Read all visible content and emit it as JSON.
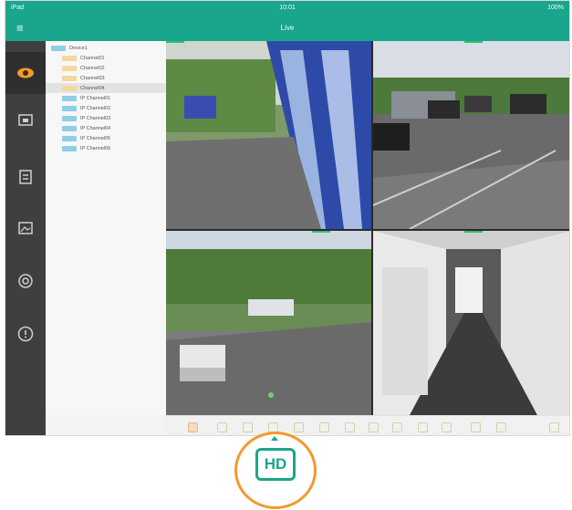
{
  "status_bar": {
    "carrier": "iPad",
    "time": "10:01",
    "battery": "100%"
  },
  "app": {
    "title": "Live",
    "menu_glyph": "≡"
  },
  "sidebar": {
    "items": [
      {
        "icon": "eye-icon",
        "active": true
      },
      {
        "icon": "playback-icon",
        "active": false
      },
      {
        "icon": "device-manager-icon",
        "active": false
      },
      {
        "icon": "image-icon",
        "active": false
      },
      {
        "icon": "settings-icon",
        "active": false
      },
      {
        "icon": "info-icon",
        "active": false
      }
    ]
  },
  "device_tree": {
    "items": [
      {
        "label": "Device1",
        "kind": "device"
      },
      {
        "label": "Channel01",
        "kind": "channel"
      },
      {
        "label": "Channel02",
        "kind": "channel"
      },
      {
        "label": "Channel03",
        "kind": "channel"
      },
      {
        "label": "Channel04",
        "kind": "channel",
        "selected": true
      },
      {
        "label": "IP Channel01",
        "kind": "ip"
      },
      {
        "label": "IP Channel02",
        "kind": "ip"
      },
      {
        "label": "IP Channel03",
        "kind": "ip"
      },
      {
        "label": "IP Channel04",
        "kind": "ip"
      },
      {
        "label": "IP Channel05",
        "kind": "ip"
      },
      {
        "label": "IP Channel06",
        "kind": "ip"
      }
    ]
  },
  "live_grid": {
    "cells": [
      {
        "scene": "building-entrance"
      },
      {
        "scene": "parking-lot"
      },
      {
        "scene": "street-view"
      },
      {
        "scene": "corridor"
      }
    ]
  },
  "toolbar": {
    "icons": [
      "hd-toggle-icon",
      "camera-icon",
      "record-icon",
      "audio-icon",
      "talk-icon",
      "home-icon",
      "ptz-icon",
      "zoom-icon",
      "grid-icon",
      "fullscreen-icon",
      "stream-icon",
      "prev-icon",
      "next-icon",
      "mode-icon"
    ]
  },
  "hd_callout": {
    "label": "HD"
  },
  "colors": {
    "accent": "#1aa68c",
    "highlight": "#f29a2e",
    "sidebar": "#3f3f3f"
  }
}
